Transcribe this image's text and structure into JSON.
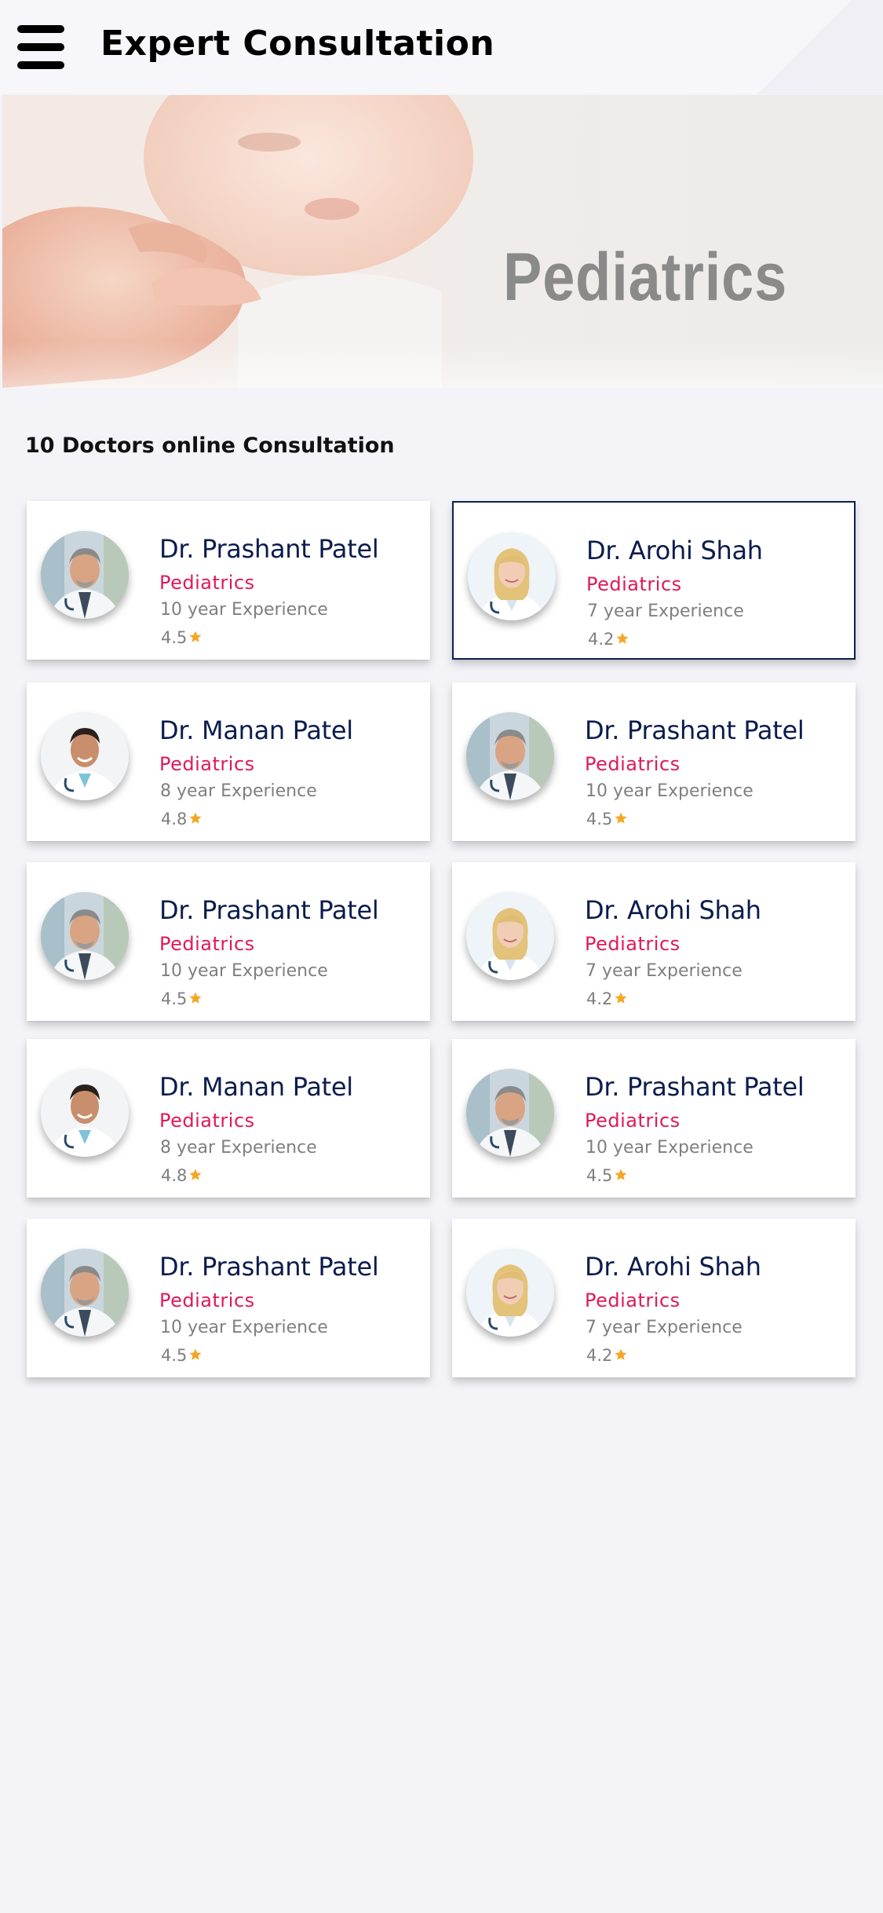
{
  "header": {
    "title": "Expert Consultation",
    "menu_icon": "hamburger-menu-icon"
  },
  "hero": {
    "title": "Pediatrics",
    "image": "baby-holding-hand-photo"
  },
  "summary": {
    "count_label": "10 Doctors online Consultation"
  },
  "colors": {
    "name": "#0b1c4d",
    "specialty": "#e0185a",
    "muted": "#7f7f7f",
    "star": "#f5a623",
    "selected_border": "#0b2150"
  },
  "doctors": [
    {
      "name": "Dr. Prashant Patel",
      "specialty": "Pediatrics",
      "experience": "10 year Experience",
      "rating": "4.5",
      "avatar": "male-doctor-gray-hair",
      "selected": false
    },
    {
      "name": "Dr. Arohi Shah",
      "specialty": "Pediatrics",
      "experience": "7 year Experience",
      "rating": "4.2",
      "avatar": "female-doctor-blonde",
      "selected": true
    },
    {
      "name": "Dr. Manan Patel",
      "specialty": "Pediatrics",
      "experience": "8 year Experience",
      "rating": "4.8",
      "avatar": "male-doctor-young",
      "selected": false
    },
    {
      "name": "Dr. Prashant Patel",
      "specialty": "Pediatrics",
      "experience": "10 year Experience",
      "rating": "4.5",
      "avatar": "male-doctor-gray-hair",
      "selected": false
    },
    {
      "name": "Dr. Prashant Patel",
      "specialty": "Pediatrics",
      "experience": "10 year Experience",
      "rating": "4.5",
      "avatar": "male-doctor-gray-hair",
      "selected": false
    },
    {
      "name": "Dr. Arohi Shah",
      "specialty": "Pediatrics",
      "experience": "7 year Experience",
      "rating": "4.2",
      "avatar": "female-doctor-blonde",
      "selected": false
    },
    {
      "name": "Dr. Manan Patel",
      "specialty": "Pediatrics",
      "experience": "8 year Experience",
      "rating": "4.8",
      "avatar": "male-doctor-young",
      "selected": false
    },
    {
      "name": "Dr. Prashant Patel",
      "specialty": "Pediatrics",
      "experience": "10 year Experience",
      "rating": "4.5",
      "avatar": "male-doctor-gray-hair",
      "selected": false
    },
    {
      "name": "Dr. Prashant Patel",
      "specialty": "Pediatrics",
      "experience": "10 year Experience",
      "rating": "4.5",
      "avatar": "male-doctor-gray-hair",
      "selected": false
    },
    {
      "name": "Dr. Arohi Shah",
      "specialty": "Pediatrics",
      "experience": "7 year Experience",
      "rating": "4.2",
      "avatar": "female-doctor-blonde",
      "selected": false
    }
  ]
}
